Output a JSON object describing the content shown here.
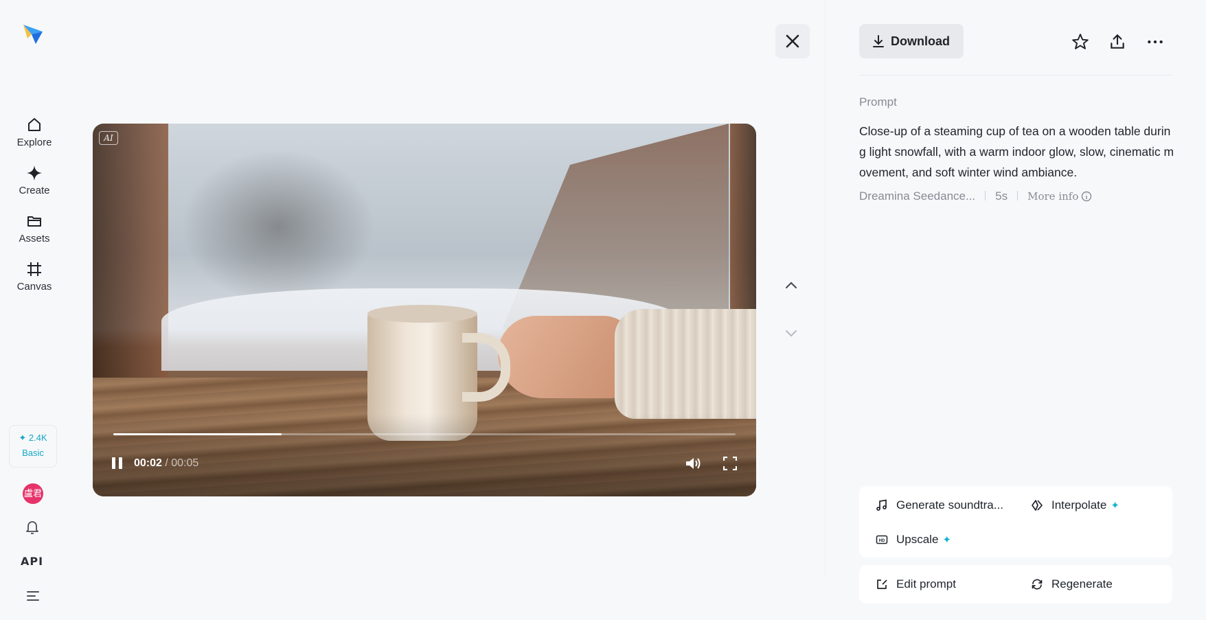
{
  "sidebar": {
    "nav": [
      {
        "label": "Explore",
        "icon": "home-icon"
      },
      {
        "label": "Create",
        "icon": "sparkle-icon"
      },
      {
        "label": "Assets",
        "icon": "folder-icon"
      },
      {
        "label": "Canvas",
        "icon": "canvas-icon"
      }
    ],
    "credits": {
      "amount": "✦ 2.4K",
      "plan": "Basic"
    },
    "avatar_text": "盧君",
    "api_label": "API"
  },
  "video": {
    "badge": "AI",
    "current_time": "00:02",
    "total_time": "/ 00:05",
    "progress": 0.27
  },
  "panel": {
    "download_label": "Download",
    "prompt_heading": "Prompt",
    "prompt_text": "Close-up of a steaming cup of tea on a wooden table during light snowfall, with a warm indoor glow, slow, cinematic movement, and soft winter wind ambiance.",
    "model": "Dreamina Seedance...",
    "duration": "5s",
    "more_info": "More info",
    "actions": {
      "soundtrack": "Generate soundtra...",
      "interpolate": "Interpolate",
      "upscale": "Upscale",
      "edit_prompt": "Edit prompt",
      "regenerate": "Regenerate"
    }
  },
  "colors": {
    "accent": "#12b3cf",
    "avatar": "#e6336b"
  }
}
